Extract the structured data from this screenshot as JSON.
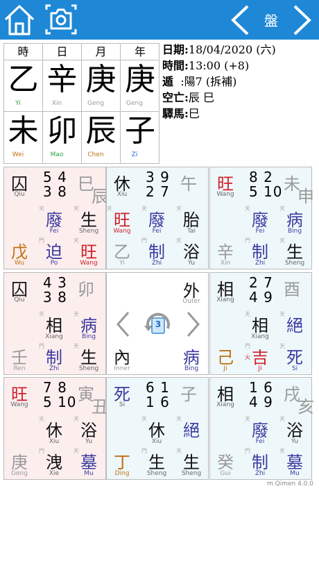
{
  "toolbar": {
    "pan_label": "盤",
    "icons": [
      "home-icon",
      "camera-icon",
      "chevron-left-icon",
      "chevron-right-icon"
    ]
  },
  "pillars": {
    "headers": [
      "時",
      "日",
      "月",
      "年"
    ],
    "stems": [
      {
        "char": "乙",
        "py": "Yi",
        "color": "#30a040"
      },
      {
        "char": "辛",
        "py": "Xin",
        "color": "#999999"
      },
      {
        "char": "庚",
        "py": "Geng",
        "color": "#999999"
      },
      {
        "char": "庚",
        "py": "Geng",
        "color": "#999999"
      }
    ],
    "branches": [
      {
        "char": "未",
        "py": "Wei",
        "color": "#c07010"
      },
      {
        "char": "卯",
        "py": "Mao",
        "color": "#30a040"
      },
      {
        "char": "辰",
        "py": "Chen",
        "color": "#c07010"
      },
      {
        "char": "子",
        "py": "Zi",
        "color": "#2060d0"
      }
    ]
  },
  "info": {
    "date_label": "日期:",
    "date_value": "18/04/2020 (六)",
    "time_label": "時間:",
    "time_value": "13:00 (+8)",
    "dun_label": "遁",
    "dun_value": "  :陽7 (拆補)",
    "void_label": "空亡:",
    "void_value": "辰 巳",
    "horse_label": "驛馬:",
    "horse_value": "巳"
  },
  "grid": {
    "cells": [
      {
        "star": "囚",
        "star_py": "Qiu",
        "n1": "5 4",
        "n2": "3 8",
        "br1": "巳",
        "br2": "辰",
        "gods": [
          "廢",
          "生"
        ],
        "gods_py": [
          "Fei",
          "Sheng"
        ],
        "stem": "戊",
        "stem_py": "Wu",
        "door": "迫",
        "door_py": "Po",
        "state": "旺",
        "state_py": "Wang"
      },
      {
        "star": "休",
        "star_py": "Xiu",
        "n1": "3 9",
        "n2": "2 7",
        "br1": "午",
        "br2": "",
        "gods": [
          "旺",
          "廢",
          "胎"
        ],
        "gods_py": [
          "Wang",
          "Fei",
          "Tai"
        ],
        "stem": "乙",
        "stem_py": "Yi",
        "door": "制",
        "door_py": "Zhi",
        "state": "浴",
        "state_py": "Yu"
      },
      {
        "star": "旺",
        "star_py": "Wang",
        "n1": "8 2",
        "n2": "5 10",
        "br1": "未",
        "br2": "申",
        "gods": [
          "廢",
          "病"
        ],
        "gods_py": [
          "Fei",
          "Bing"
        ],
        "stem": "辛",
        "stem_py": "Xin",
        "door": "制",
        "door_py": "Zhi",
        "state": "生",
        "state_py": "Sheng"
      },
      {
        "star": "囚",
        "star_py": "Qiu",
        "n1": "4 3",
        "n2": "3 8",
        "br1": "卯",
        "br2": "",
        "gods": [
          "相",
          "病"
        ],
        "gods_py": [
          "Xiang",
          "Bing"
        ],
        "stem": "壬",
        "stem_py": "Ren",
        "door": "制",
        "door_py": "Zhi",
        "state": "生",
        "state_py": "Sheng"
      },
      {
        "outer": "外",
        "outer_py": "Outer",
        "inner": "內",
        "inner_py": "Inner",
        "state": "病",
        "state_py": "Bing",
        "badge": "3"
      },
      {
        "star": "相",
        "star_py": "Xiang",
        "n1": "2 7",
        "n2": "4 9",
        "br1": "酉",
        "br2": "",
        "gods": [
          "相",
          "絕"
        ],
        "gods_py": [
          "Xiang",
          ""
        ],
        "stem": "己",
        "stem_py": "Ji",
        "door": "吉",
        "door_py": "Ji",
        "state": "死",
        "state_py": "Si"
      },
      {
        "star": "旺",
        "star_py": "Wang",
        "n1": "7 8",
        "n2": "5 10",
        "br1": "寅",
        "br2": "丑",
        "gods": [
          "休",
          "浴"
        ],
        "gods_py": [
          "Xiu",
          "Yu"
        ],
        "stem": "庚",
        "stem_py": "Geng",
        "door": "洩",
        "door_py": "Xie",
        "state": "墓",
        "state_py": "Mu"
      },
      {
        "star": "死",
        "star_py": "Si",
        "n1": "6 1",
        "n2": "1 6",
        "br1": "子",
        "br2": "",
        "gods": [
          "休",
          "絕"
        ],
        "gods_py": [
          "Xiu",
          ""
        ],
        "stem": "丁",
        "stem_py": "Ding",
        "door": "生",
        "door_py": "Sheng",
        "state": "生",
        "state_py": "Sheng"
      },
      {
        "star": "相",
        "star_py": "Xiang",
        "n1": "1 6",
        "n2": "4 9",
        "br1": "戌",
        "br2": "亥",
        "gods": [
          "廢",
          "浴"
        ],
        "gods_py": [
          "Fei",
          "Yu"
        ],
        "stem": "癸",
        "stem_py": "Gui",
        "door": "制",
        "door_py": "Zhi",
        "state": "墓",
        "state_py": "Mu"
      }
    ],
    "tags": {
      "tian": "天",
      "men": "門",
      "huo": "火"
    }
  },
  "version": "m.Qimen 4.0.0"
}
